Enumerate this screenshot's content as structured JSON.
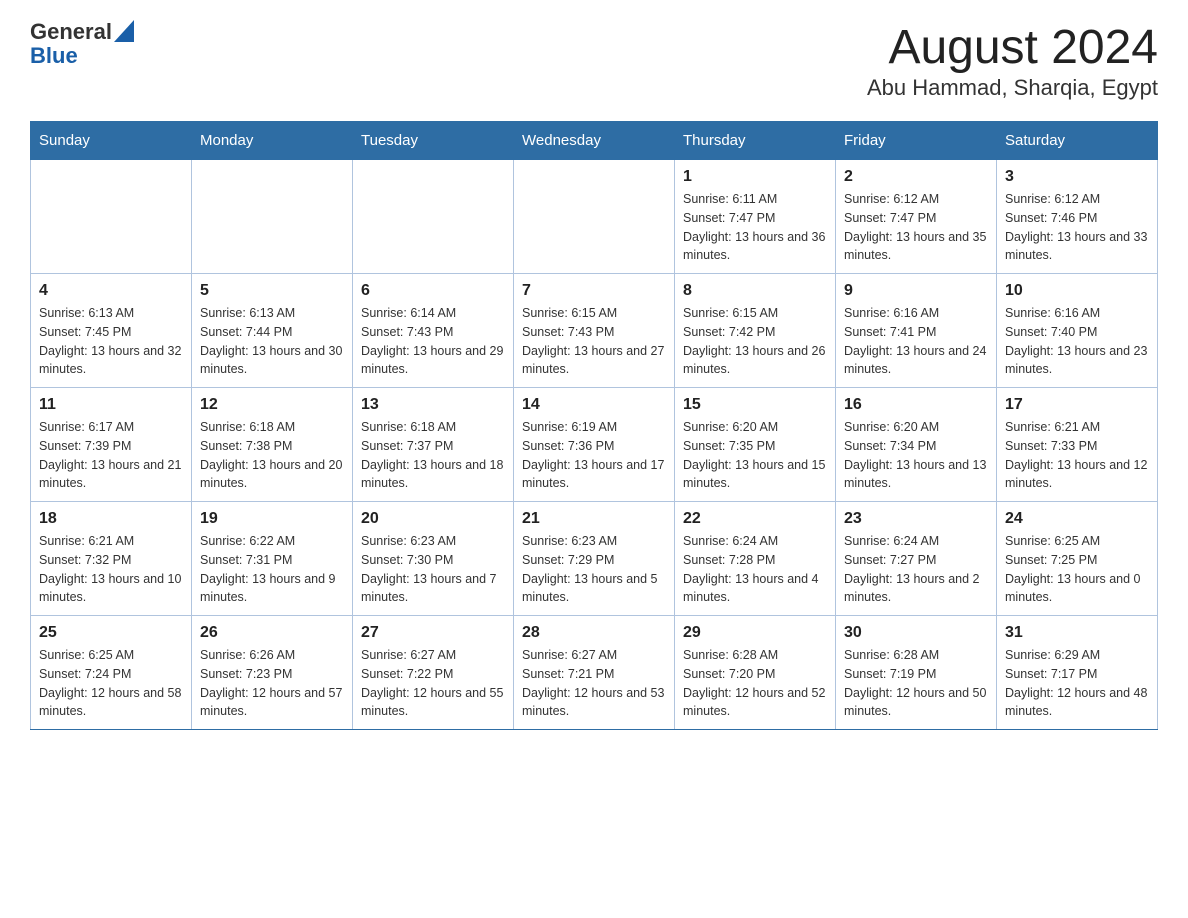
{
  "header": {
    "logo_general": "General",
    "logo_blue": "Blue",
    "month_title": "August 2024",
    "location": "Abu Hammad, Sharqia, Egypt"
  },
  "weekdays": [
    "Sunday",
    "Monday",
    "Tuesday",
    "Wednesday",
    "Thursday",
    "Friday",
    "Saturday"
  ],
  "weeks": [
    [
      {
        "day": "",
        "info": ""
      },
      {
        "day": "",
        "info": ""
      },
      {
        "day": "",
        "info": ""
      },
      {
        "day": "",
        "info": ""
      },
      {
        "day": "1",
        "info": "Sunrise: 6:11 AM\nSunset: 7:47 PM\nDaylight: 13 hours and 36 minutes."
      },
      {
        "day": "2",
        "info": "Sunrise: 6:12 AM\nSunset: 7:47 PM\nDaylight: 13 hours and 35 minutes."
      },
      {
        "day": "3",
        "info": "Sunrise: 6:12 AM\nSunset: 7:46 PM\nDaylight: 13 hours and 33 minutes."
      }
    ],
    [
      {
        "day": "4",
        "info": "Sunrise: 6:13 AM\nSunset: 7:45 PM\nDaylight: 13 hours and 32 minutes."
      },
      {
        "day": "5",
        "info": "Sunrise: 6:13 AM\nSunset: 7:44 PM\nDaylight: 13 hours and 30 minutes."
      },
      {
        "day": "6",
        "info": "Sunrise: 6:14 AM\nSunset: 7:43 PM\nDaylight: 13 hours and 29 minutes."
      },
      {
        "day": "7",
        "info": "Sunrise: 6:15 AM\nSunset: 7:43 PM\nDaylight: 13 hours and 27 minutes."
      },
      {
        "day": "8",
        "info": "Sunrise: 6:15 AM\nSunset: 7:42 PM\nDaylight: 13 hours and 26 minutes."
      },
      {
        "day": "9",
        "info": "Sunrise: 6:16 AM\nSunset: 7:41 PM\nDaylight: 13 hours and 24 minutes."
      },
      {
        "day": "10",
        "info": "Sunrise: 6:16 AM\nSunset: 7:40 PM\nDaylight: 13 hours and 23 minutes."
      }
    ],
    [
      {
        "day": "11",
        "info": "Sunrise: 6:17 AM\nSunset: 7:39 PM\nDaylight: 13 hours and 21 minutes."
      },
      {
        "day": "12",
        "info": "Sunrise: 6:18 AM\nSunset: 7:38 PM\nDaylight: 13 hours and 20 minutes."
      },
      {
        "day": "13",
        "info": "Sunrise: 6:18 AM\nSunset: 7:37 PM\nDaylight: 13 hours and 18 minutes."
      },
      {
        "day": "14",
        "info": "Sunrise: 6:19 AM\nSunset: 7:36 PM\nDaylight: 13 hours and 17 minutes."
      },
      {
        "day": "15",
        "info": "Sunrise: 6:20 AM\nSunset: 7:35 PM\nDaylight: 13 hours and 15 minutes."
      },
      {
        "day": "16",
        "info": "Sunrise: 6:20 AM\nSunset: 7:34 PM\nDaylight: 13 hours and 13 minutes."
      },
      {
        "day": "17",
        "info": "Sunrise: 6:21 AM\nSunset: 7:33 PM\nDaylight: 13 hours and 12 minutes."
      }
    ],
    [
      {
        "day": "18",
        "info": "Sunrise: 6:21 AM\nSunset: 7:32 PM\nDaylight: 13 hours and 10 minutes."
      },
      {
        "day": "19",
        "info": "Sunrise: 6:22 AM\nSunset: 7:31 PM\nDaylight: 13 hours and 9 minutes."
      },
      {
        "day": "20",
        "info": "Sunrise: 6:23 AM\nSunset: 7:30 PM\nDaylight: 13 hours and 7 minutes."
      },
      {
        "day": "21",
        "info": "Sunrise: 6:23 AM\nSunset: 7:29 PM\nDaylight: 13 hours and 5 minutes."
      },
      {
        "day": "22",
        "info": "Sunrise: 6:24 AM\nSunset: 7:28 PM\nDaylight: 13 hours and 4 minutes."
      },
      {
        "day": "23",
        "info": "Sunrise: 6:24 AM\nSunset: 7:27 PM\nDaylight: 13 hours and 2 minutes."
      },
      {
        "day": "24",
        "info": "Sunrise: 6:25 AM\nSunset: 7:25 PM\nDaylight: 13 hours and 0 minutes."
      }
    ],
    [
      {
        "day": "25",
        "info": "Sunrise: 6:25 AM\nSunset: 7:24 PM\nDaylight: 12 hours and 58 minutes."
      },
      {
        "day": "26",
        "info": "Sunrise: 6:26 AM\nSunset: 7:23 PM\nDaylight: 12 hours and 57 minutes."
      },
      {
        "day": "27",
        "info": "Sunrise: 6:27 AM\nSunset: 7:22 PM\nDaylight: 12 hours and 55 minutes."
      },
      {
        "day": "28",
        "info": "Sunrise: 6:27 AM\nSunset: 7:21 PM\nDaylight: 12 hours and 53 minutes."
      },
      {
        "day": "29",
        "info": "Sunrise: 6:28 AM\nSunset: 7:20 PM\nDaylight: 12 hours and 52 minutes."
      },
      {
        "day": "30",
        "info": "Sunrise: 6:28 AM\nSunset: 7:19 PM\nDaylight: 12 hours and 50 minutes."
      },
      {
        "day": "31",
        "info": "Sunrise: 6:29 AM\nSunset: 7:17 PM\nDaylight: 12 hours and 48 minutes."
      }
    ]
  ]
}
